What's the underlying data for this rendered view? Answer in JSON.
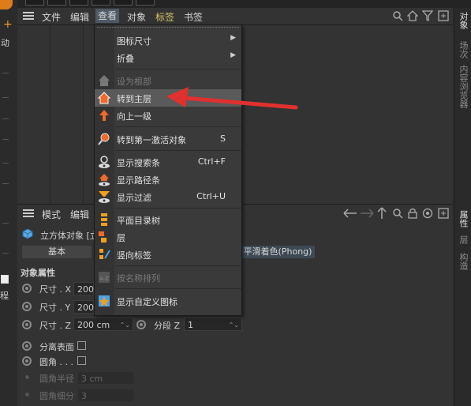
{
  "left_strip": {
    "top_label": "动",
    "bottom_label": "程"
  },
  "object_manager": {
    "menu": {
      "items": [
        "文件",
        "编辑",
        "查看",
        "对象",
        "标签",
        "书签"
      ],
      "active": "查看",
      "yellow": "标签"
    }
  },
  "right_tabs": {
    "top": [
      "对象",
      "场次",
      "内容浏览器"
    ],
    "bottom": [
      "属性",
      "层",
      "构造"
    ]
  },
  "view_menu": {
    "items": [
      {
        "label": "图标尺寸",
        "shortcut": "",
        "submenu": true,
        "disabled": false,
        "icon": "none"
      },
      {
        "label": "折叠",
        "shortcut": "",
        "submenu": true,
        "disabled": false,
        "icon": "none"
      },
      {
        "label": "设为根部",
        "shortcut": "",
        "submenu": false,
        "disabled": true,
        "icon": "home-dim-icon"
      },
      {
        "label": "转到主层",
        "shortcut": "",
        "submenu": false,
        "disabled": false,
        "icon": "home-icon",
        "highlighted": true
      },
      {
        "label": "向上一级",
        "shortcut": "",
        "submenu": false,
        "disabled": false,
        "icon": "arrow-up-icon"
      },
      {
        "label": "转到第一激活对象",
        "shortcut": "S",
        "submenu": false,
        "disabled": false,
        "icon": "magnifier-icon"
      },
      {
        "label": "显示搜索条",
        "shortcut": "Ctrl+F",
        "submenu": false,
        "disabled": false,
        "icon": "search-eye-icon"
      },
      {
        "label": "显示路径条",
        "shortcut": "",
        "submenu": false,
        "disabled": false,
        "icon": "path-eye-icon"
      },
      {
        "label": "显示过滤",
        "shortcut": "Ctrl+U",
        "submenu": false,
        "disabled": false,
        "icon": "filter-eye-icon"
      },
      {
        "label": "平面目录树",
        "shortcut": "",
        "submenu": false,
        "disabled": false,
        "icon": "flat-tree-icon"
      },
      {
        "label": "层",
        "shortcut": "",
        "submenu": false,
        "disabled": false,
        "icon": "layer-icon"
      },
      {
        "label": "竖向标签",
        "shortcut": "",
        "submenu": false,
        "disabled": false,
        "icon": "vertical-tags-icon"
      },
      {
        "label": "按名称排列",
        "shortcut": "",
        "submenu": false,
        "disabled": true,
        "icon": "sort-az-icon"
      },
      {
        "label": "显示自定义图标",
        "shortcut": "",
        "submenu": false,
        "disabled": false,
        "icon": "custom-icon-eye-icon"
      }
    ]
  },
  "attribute_manager": {
    "menu": [
      "模式",
      "编辑"
    ],
    "object_title": "立方体对象 [立",
    "tabs": [
      "基本",
      "平滑着色(Phong)"
    ],
    "section": "对象属性",
    "rows": [
      {
        "label": "尺寸 . X",
        "value": "200"
      },
      {
        "label": "尺寸 . Y",
        "value": "200"
      },
      {
        "label": "尺寸 . Z",
        "value": "200 cm",
        "seg_label": "分段 Z",
        "seg_value": "1"
      }
    ],
    "checks": [
      {
        "label": "分离表面",
        "dim": false
      },
      {
        "label": "圆角 . . .",
        "dim": false
      },
      {
        "label": "圆角半径",
        "value": "3 cm",
        "dim": true
      },
      {
        "label": "圆角细分",
        "value": "3",
        "dim": true
      }
    ]
  },
  "colors": {
    "accent_red": "#e0312f",
    "highlight": "#5a5a5a",
    "menu_active": "#4d5a66"
  }
}
